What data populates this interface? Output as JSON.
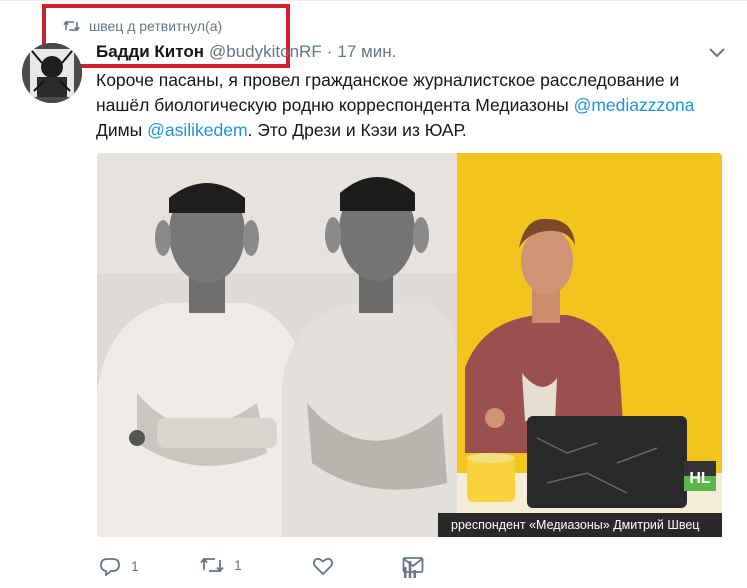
{
  "retweet": {
    "text": "швец д ретвитнул(а)"
  },
  "tweet": {
    "author_name": "Бадди Китон",
    "author_handle": "@budykitonRF",
    "separator": "·",
    "time": "17 мин.",
    "text_parts": {
      "part1": "Короче пасаны, я провел гражданское журналистское расследование и нашёл биологическую родню корреспондента Медиазоны ",
      "mention1": "@mediazzzona",
      "part2": " Димы ",
      "mention2": "@asilikedem",
      "part3": ". Это Дрези и Кэзи из ЮАР."
    },
    "media": {
      "caption": "рреспондент «Медиазоны» Дмитрий Швец",
      "logo_text": "HL"
    }
  },
  "actions": {
    "reply_count": "1",
    "retweet_count": "1"
  },
  "colors": {
    "link": "#1b95e0",
    "muted": "#657786",
    "highlight_box": "#d0202a",
    "yellow_bg": "#f2c51e"
  }
}
